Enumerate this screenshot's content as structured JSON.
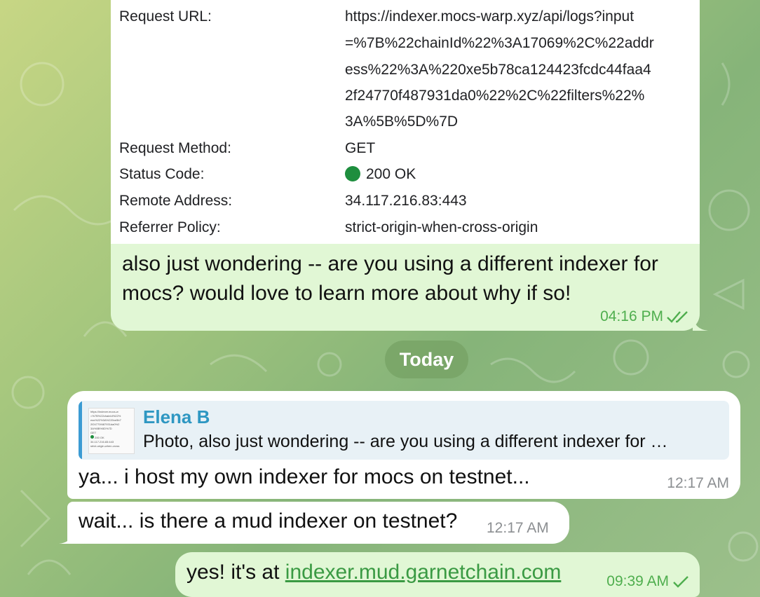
{
  "photo_headers": {
    "request_url_label": "Request URL:",
    "request_url_lines": [
      "https://indexer.mocs-warp.xyz/api/logs?input",
      "=%7B%22chainId%22%3A17069%2C%22addr",
      "ess%22%3A%220xe5b78ca124423fcdc44faa4",
      "2f24770f487931da0%22%2C%22filters%22%",
      "3A%5B%5D%7D"
    ],
    "request_method_label": "Request Method:",
    "request_method_value": "GET",
    "status_code_label": "Status Code:",
    "status_code_value": "200 OK",
    "remote_address_label": "Remote Address:",
    "remote_address_value": "34.117.216.83:443",
    "referrer_policy_label": "Referrer Policy:",
    "referrer_policy_value": "strict-origin-when-cross-origin"
  },
  "messages": {
    "out1_text": "also just wondering -- are you using a different indexer for mocs? would love to learn more about why if so!",
    "out1_time": "04:16 PM",
    "date_separator": "Today",
    "reply_name": "Elena B",
    "reply_text": "Photo, also just wondering -- are you using a different indexer for …",
    "in1_text": "ya... i host my own indexer for mocs on testnet...",
    "in1_time": "12:17 AM",
    "in2_text": "wait... is there a mud indexer on testnet?",
    "in2_time": "12:17 AM",
    "out2_prefix": "yes! it's at ",
    "out2_link": "indexer.mud.garnetchain.com",
    "out2_time": "09:39 AM"
  },
  "colors": {
    "outgoing_bubble": "#e1f7d5",
    "incoming_bubble": "#ffffff",
    "accent_green": "#4fae4e",
    "reply_name": "#2e97c2",
    "status_ok": "#1e8e3e"
  }
}
